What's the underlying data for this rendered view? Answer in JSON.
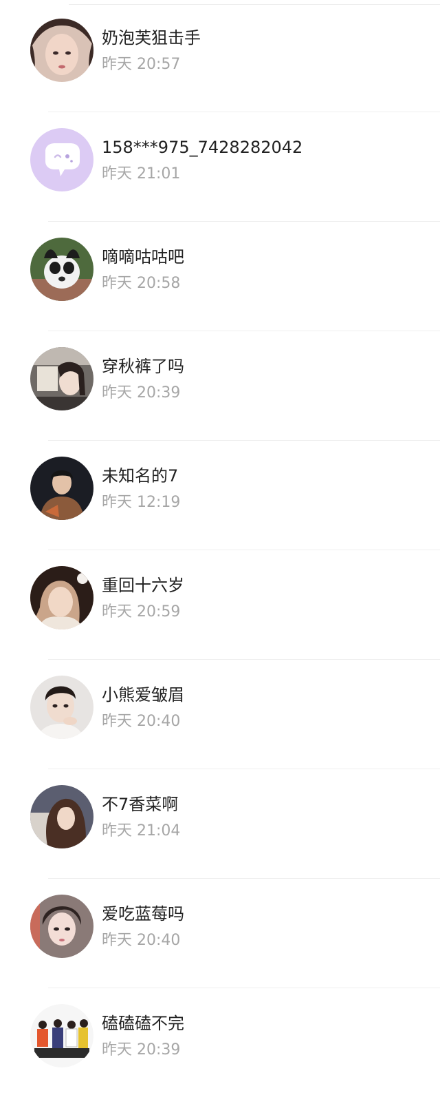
{
  "contacts": [
    {
      "name": "奶泡芙狙击手",
      "time": "昨天 20:57",
      "avatar": "avatar-photo-girl"
    },
    {
      "name": "158***975_7428282042",
      "time": "昨天 21:01",
      "avatar": "chat-bubble-icon",
      "avatar_color": "#d9c8f3"
    },
    {
      "name": "嘀嘀咕咕吧",
      "time": "昨天 20:58",
      "avatar": "avatar-photo-dog"
    },
    {
      "name": "穿秋裤了吗",
      "time": "昨天 20:39",
      "avatar": "avatar-photo-girl"
    },
    {
      "name": "未知名的7",
      "time": "昨天 12:19",
      "avatar": "avatar-photo-boy"
    },
    {
      "name": "重回十六岁",
      "time": "昨天 20:59",
      "avatar": "avatar-photo-girl"
    },
    {
      "name": "小熊爱皱眉",
      "time": "昨天 20:40",
      "avatar": "avatar-photo-boy"
    },
    {
      "name": "不7香菜啊",
      "time": "昨天 21:04",
      "avatar": "avatar-photo-girl"
    },
    {
      "name": "爱吃蓝莓吗",
      "time": "昨天 20:40",
      "avatar": "avatar-photo-boy"
    },
    {
      "name": "磕磕磕不完",
      "time": "昨天 20:39",
      "avatar": "avatar-photo-group"
    }
  ]
}
